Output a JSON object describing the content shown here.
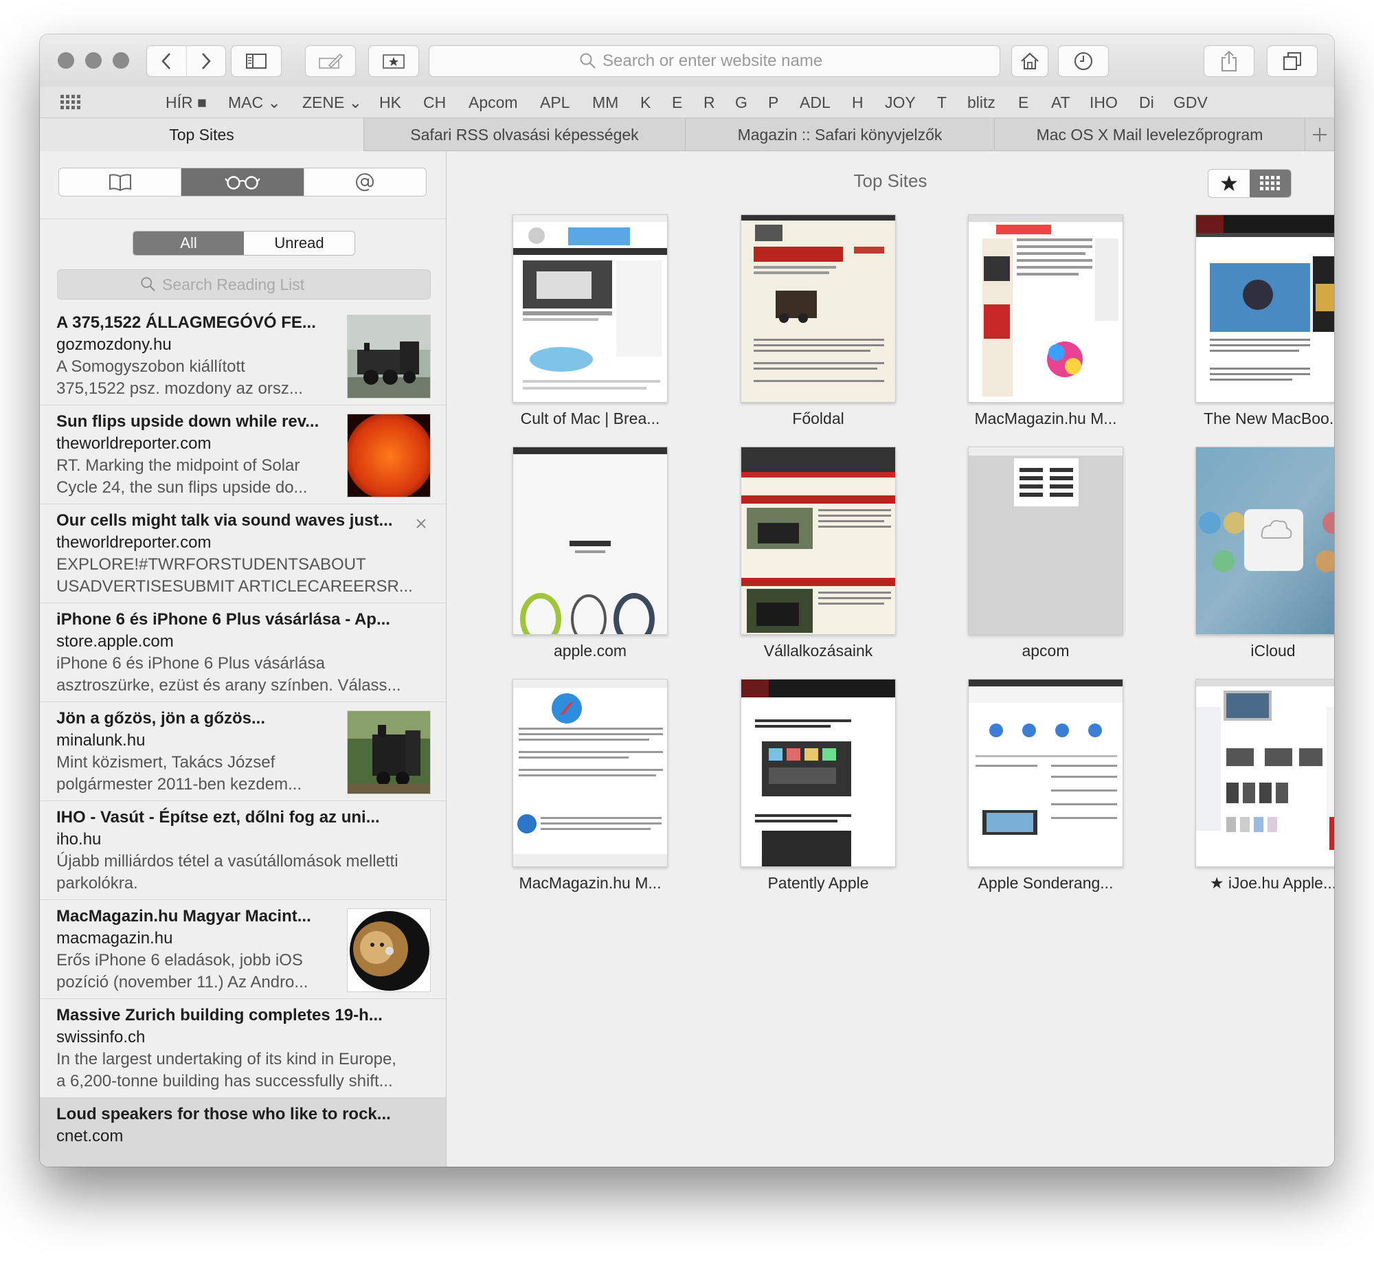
{
  "toolbar": {
    "search_placeholder": "Search or enter website name"
  },
  "favorites": [
    {
      "label": "HÍR ■"
    },
    {
      "label": "MAC ⌄"
    },
    {
      "label": "ZENE ⌄"
    },
    {
      "label": "HK"
    },
    {
      "label": "CH"
    },
    {
      "label": "Apcom"
    },
    {
      "label": "APL"
    },
    {
      "label": "MM"
    },
    {
      "label": "K"
    },
    {
      "label": "E"
    },
    {
      "label": "R"
    },
    {
      "label": "G"
    },
    {
      "label": "P"
    },
    {
      "label": "ADL"
    },
    {
      "label": "H"
    },
    {
      "label": "JOY"
    },
    {
      "label": "T"
    },
    {
      "label": "blitz"
    },
    {
      "label": "E"
    },
    {
      "label": "AT"
    },
    {
      "label": "IHO"
    },
    {
      "label": "Di"
    },
    {
      "label": "GDV"
    }
  ],
  "tabs": [
    {
      "label": "Top Sites"
    },
    {
      "label": "Safari RSS olvasási képességek"
    },
    {
      "label": "Magazin :: Safari könyvjelzők"
    },
    {
      "label": "Mac OS X Mail levelezőprogram"
    }
  ],
  "sidebar": {
    "filter": {
      "all": "All",
      "unread": "Unread"
    },
    "search_placeholder": "Search Reading List",
    "items": [
      {
        "title": "A 375,1522 ÁLLAGMEGÓVÓ FE...",
        "domain": "gozmozdony.hu",
        "desc1": "A Somogyszobon kiállított",
        "desc2": "375,1522 psz. mozdony az orsz..."
      },
      {
        "title": "Sun flips upside down while rev...",
        "domain": "theworldreporter.com",
        "desc1": "RT. Marking the midpoint of Solar",
        "desc2": "Cycle 24, the sun flips upside do..."
      },
      {
        "title": "Our cells might talk via sound waves just...",
        "domain": "theworldreporter.com",
        "desc1": "EXPLORE!#TWRFORSTUDENTSABOUT",
        "desc2": "USADVERTISESUBMIT ARTICLECAREERSR..."
      },
      {
        "title": "iPhone 6 és iPhone 6 Plus vásárlása - Ap...",
        "domain": "store.apple.com",
        "desc1": "iPhone 6 és iPhone 6 Plus vásárlása",
        "desc2": "asztroszürke, ezüst és arany színben. Válass..."
      },
      {
        "title": "Jön a gőzös, jön a gőzös...",
        "domain": "minalunk.hu",
        "desc1": "Mint közismert, Takács József",
        "desc2": "polgármester 2011-ben kezdem..."
      },
      {
        "title": "IHO - Vasút - Építse ezt, dőlni fog az uni...",
        "domain": "iho.hu",
        "desc1": "Újabb milliárdos tétel a vasútállomások melletti",
        "desc2": "parkolókra."
      },
      {
        "title": "MacMagazin.hu Magyar Macint...",
        "domain": "macmagazin.hu",
        "desc1": "Erős iPhone 6 eladások, jobb iOS",
        "desc2": "pozíció (november 11.) Az Andro..."
      },
      {
        "title": "Massive Zurich building completes 19-h...",
        "domain": "swissinfo.ch",
        "desc1": "In the largest undertaking of its kind in Europe,",
        "desc2": "a 6,200-tonne building has successfully shift..."
      },
      {
        "title": "Loud speakers for those who like to rock...",
        "domain": "cnet.com",
        "desc1": "",
        "desc2": ""
      }
    ]
  },
  "main": {
    "title": "Top Sites",
    "sites": [
      {
        "label": "Cult of Mac | Brea..."
      },
      {
        "label": "Főoldal"
      },
      {
        "label": "MacMagazin.hu M..."
      },
      {
        "label": "The New MacBoo..."
      },
      {
        "label": "apple.com"
      },
      {
        "label": "Vállalkozásaink"
      },
      {
        "label": "apcom"
      },
      {
        "label": "iCloud"
      },
      {
        "label": "MacMagazin.hu M..."
      },
      {
        "label": "Patently Apple"
      },
      {
        "label": "Apple Sonderang..."
      },
      {
        "label": "★ iJoe.hu Apple..."
      }
    ]
  },
  "colors": {
    "window_bg": "#efefef",
    "selected_segment": "#6f6f6f",
    "selected_row": "#d9d9d9"
  }
}
